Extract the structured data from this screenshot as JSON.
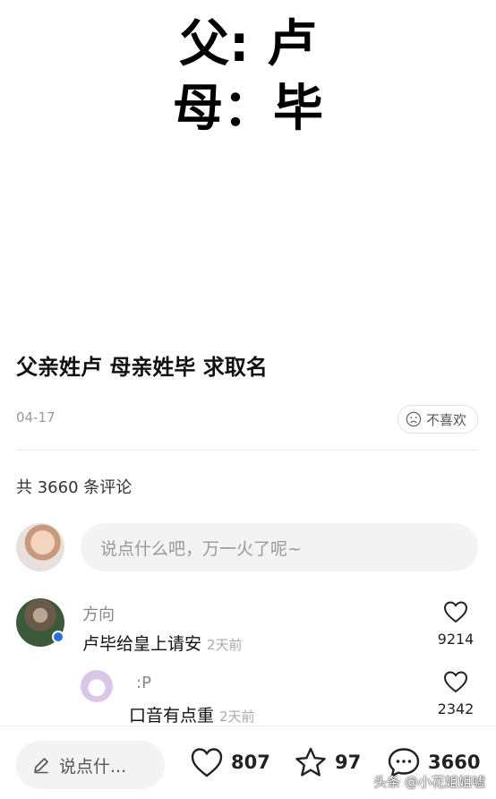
{
  "hero": {
    "line1": "父: 卢",
    "line2": "母：毕"
  },
  "post": {
    "title": "父亲姓卢 母亲姓毕 求取名",
    "date": "04-17",
    "dislike_label": "不喜欢"
  },
  "comments_header": "共 3660 条评论",
  "composer": {
    "placeholder": "说点什么吧，万一火了呢~"
  },
  "comments": [
    {
      "author": "方向",
      "text": "卢毕给皇上请安",
      "time": "2天前",
      "likes": "9214"
    },
    {
      "author": ":P",
      "text": "口音有点重",
      "time": "2天前",
      "likes": "2342"
    }
  ],
  "bottom_bar": {
    "say_label": "说点什...",
    "like_count": "807",
    "fav_count": "97",
    "comment_count": "3660"
  },
  "watermark": "头条 @小花姐姐嘘",
  "icons": {
    "dislike": "frown-face-icon",
    "like": "heart-icon",
    "favorite": "star-icon",
    "comment": "speech-bubble-icon",
    "edit": "pencil-icon"
  }
}
